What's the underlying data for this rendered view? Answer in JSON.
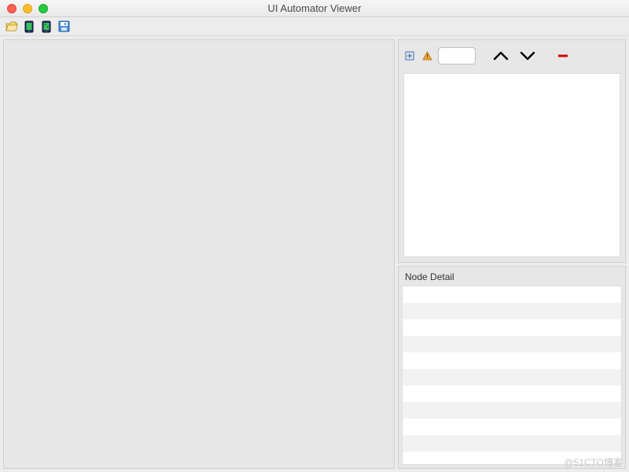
{
  "window": {
    "title": "UI Automator Viewer"
  },
  "toolbar": {
    "icons": {
      "open": "open-folder-icon",
      "screenshot1": "device-screenshot-icon",
      "screenshot2": "device-screenshot-compressed-icon",
      "save": "save-icon"
    }
  },
  "rightPanel": {
    "controls": {
      "expand": "expand-all-icon",
      "warning": "toggle-naf-icon",
      "searchValue": "",
      "searchPlaceholder": "",
      "prev": "prev-icon",
      "next": "next-icon",
      "remove": "remove-icon"
    },
    "nodeDetail": {
      "title": "Node Detail",
      "rows": [
        "",
        "",
        "",
        "",
        "",
        "",
        "",
        "",
        "",
        ""
      ]
    }
  },
  "watermark": "@51CTO博客"
}
